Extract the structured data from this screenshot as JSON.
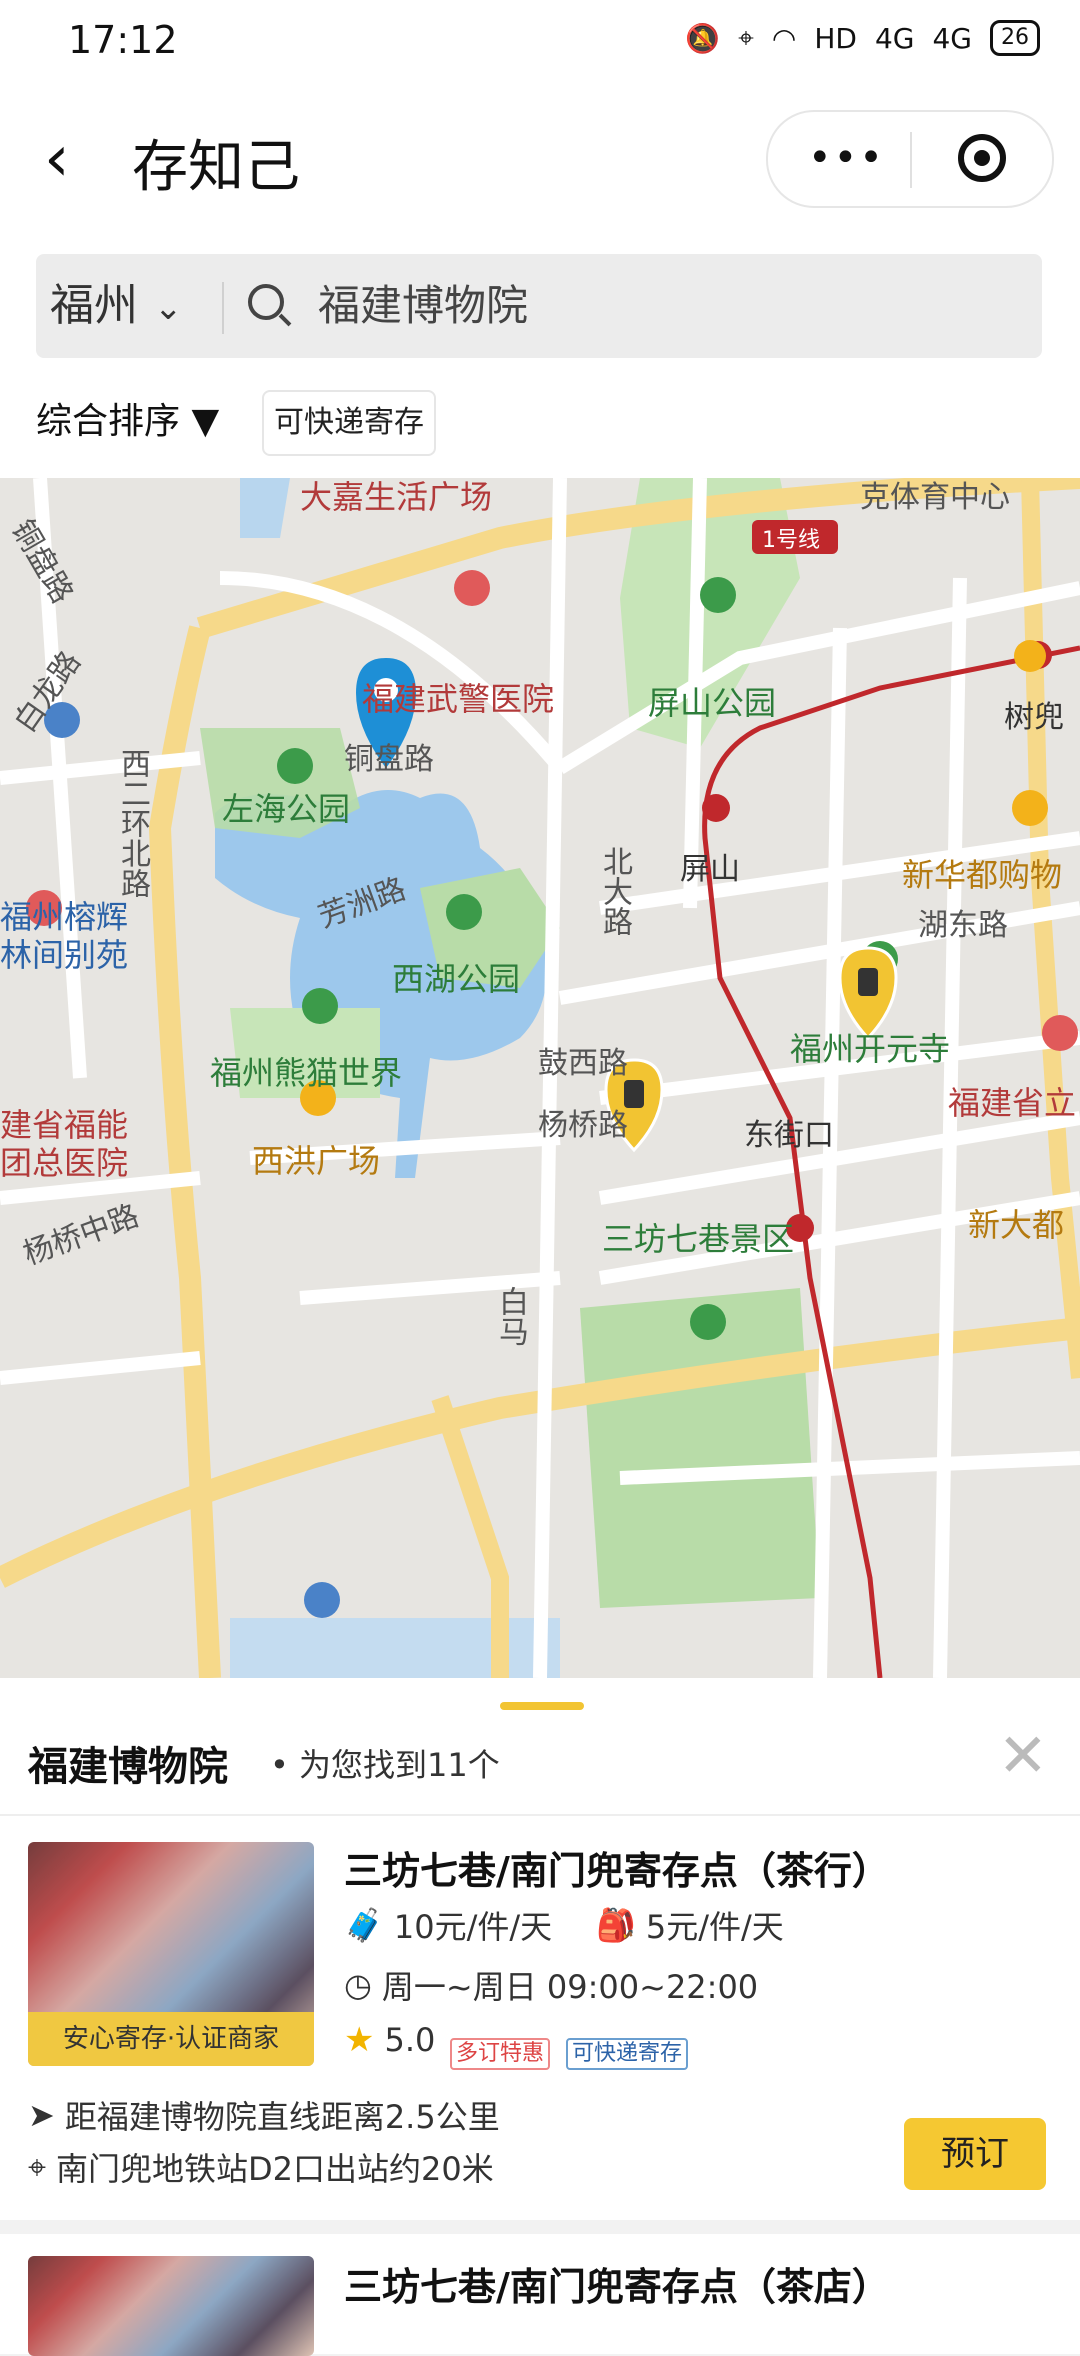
{
  "status_bar": {
    "time": "17:12",
    "network1": "4G",
    "network2": "4G",
    "hd": "HD",
    "battery": "26"
  },
  "nav": {
    "title": "存知己",
    "more": "•••"
  },
  "search": {
    "city": "福州",
    "query": "福建博物院"
  },
  "filters": {
    "sort_label": "综合排序 ▼",
    "tag": "可快递寄存"
  },
  "map": {
    "labels": {
      "top_left": "大嘉生活广场",
      "top_right": "克体育中心",
      "hospital": "福建武警医院",
      "pingshan_park": "屏山公园",
      "tongpan": "铜盘路",
      "tongpan_vert": "铜盘路",
      "bailong": "白龙路",
      "xi2": "西二环北路",
      "zuohai": "左海公园",
      "line1": "1号线",
      "shuji": "树兜",
      "pingshan": "屏山",
      "xinhuadu": "新华都购物",
      "beida": "北大路",
      "hudong": "湖东路",
      "fangong": "芳洲路",
      "rongshu": "福州榕辉林间别苑",
      "xihu": "西湖公园",
      "kaiyuan": "福州开元寺",
      "guxi": "鼓西路",
      "panda": "福州熊猫世界",
      "fuzhou_prov": "福建省立",
      "fuzhou_hosp": "建省福能团总医院",
      "yangqiao": "杨桥路",
      "dongjie": "东街口",
      "xihong": "西洪广场",
      "sanfang": "三坊七巷景区",
      "xinda": "新大都",
      "yangqiao_mid": "杨桥中路",
      "bai": "白马"
    }
  },
  "result": {
    "title": "福建博物院",
    "subtitle": "• 为您找到11个",
    "close": "✕",
    "items": [
      {
        "name": "三坊七巷/南门兜寄存点（茶行）",
        "price_large": "10元/件/天",
        "price_small": "5元/件/天",
        "hours": "周一~周日 09:00~22:00",
        "rating": "5.0",
        "badge1": "多订特惠",
        "badge2": "可快递寄存",
        "thumb_label": "安心寄存·认证商家",
        "distance": "距福建博物院直线距离2.5公里",
        "subway": "南门兜地铁站D2口出站约20米",
        "book": "预订"
      },
      {
        "name": "三坊七巷/南门兜寄存点（茶店）"
      }
    ]
  },
  "colors": {
    "accent": "#f5c832",
    "metro": "#c0282c",
    "water": "#9dc8ec",
    "park": "#b8dca8"
  }
}
